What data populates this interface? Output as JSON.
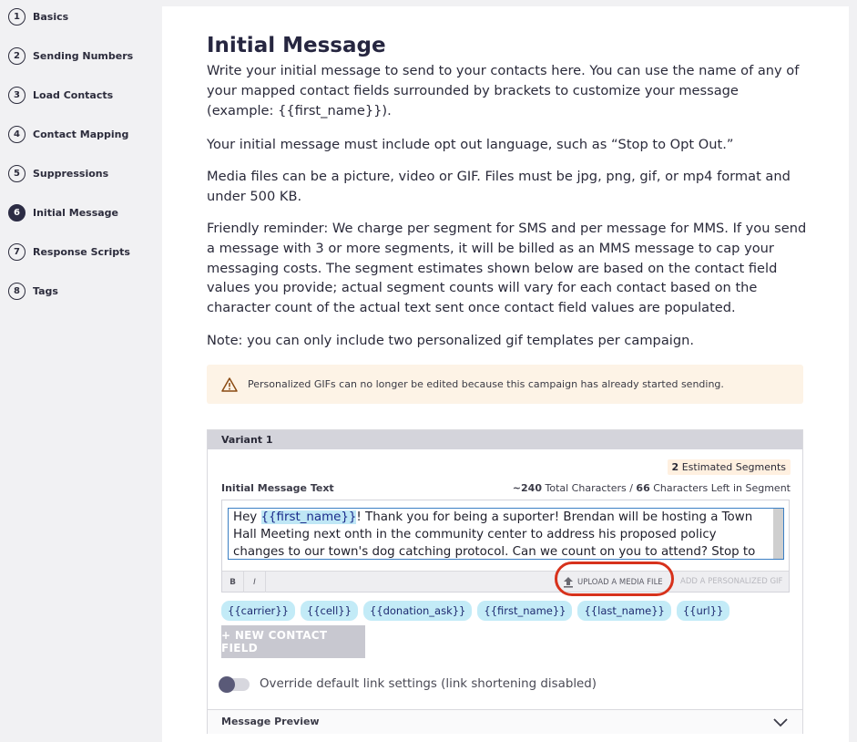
{
  "steps": [
    {
      "num": "1",
      "label": "Basics",
      "active": false
    },
    {
      "num": "2",
      "label": "Sending Numbers",
      "active": false
    },
    {
      "num": "3",
      "label": "Load Contacts",
      "active": false
    },
    {
      "num": "4",
      "label": "Contact Mapping",
      "active": false
    },
    {
      "num": "5",
      "label": "Suppressions",
      "active": false
    },
    {
      "num": "6",
      "label": "Initial Message",
      "active": true
    },
    {
      "num": "7",
      "label": "Response Scripts",
      "active": false
    },
    {
      "num": "8",
      "label": "Tags",
      "active": false
    }
  ],
  "main": {
    "title": "Initial Message",
    "para1": "Write your initial message to send to your contacts here. You can use the name of any of your mapped contact fields surrounded by brackets to customize your message (example: {{first_name}}).",
    "para2": "Your initial message must include opt out language, such as “Stop to Opt Out.”",
    "para3": "Media files can be a picture, video or GIF. Files must be jpg, png, gif, or mp4 format and under 500 KB.",
    "para4": "Friendly reminder: We charge per segment for SMS and per message for MMS. If you send a message with 3 or more segments, it will be billed as an MMS message to cap your messaging costs. The segment estimates shown below are based on the contact field values you provide; actual segment counts will vary for each contact based on the character count of the actual text sent once contact field values are populated.",
    "para5": "Note: you can only include two personalized gif templates per campaign.",
    "warning": "Personalized GIFs can no longer be edited because this campaign has already started sending."
  },
  "variant": {
    "header": "Variant 1",
    "segments_count": "2",
    "segments_label": "Estimated Segments",
    "text_label": "Initial Message Text",
    "total_chars": "~240",
    "total_chars_label": "Total Characters / ",
    "chars_left": "66",
    "chars_left_label": "Characters Left in Segment",
    "message_pre": "Hey ",
    "message_tag": "{{first_name}}",
    "message_post": "! Thank you for being a suporter! Brendan will be hosting a Town Hall Meeting next onth in the community center to address his proposed policy changes to our town's dog catching protocol. Can we count on you to attend? Stop to opt out",
    "bold_btn": "B",
    "italic_btn": "I",
    "upload_label": "UPLOAD A MEDIA FILE",
    "add_gif_label": "ADD A PERSONALIZED GIF",
    "chips": [
      "{{carrier}}",
      "{{cell}}",
      "{{donation_ask}}",
      "{{first_name}}",
      "{{last_name}}",
      "{{url}}"
    ],
    "new_field_label": "+ NEW CONTACT FIELD",
    "toggle_label": "Override default link settings (link shortening disabled)",
    "preview_label": "Message Preview"
  },
  "colors": {
    "accent_highlight": "#d7321c",
    "chip_bg": "#c3ebf7",
    "warning_bg": "#fdf3e6"
  }
}
